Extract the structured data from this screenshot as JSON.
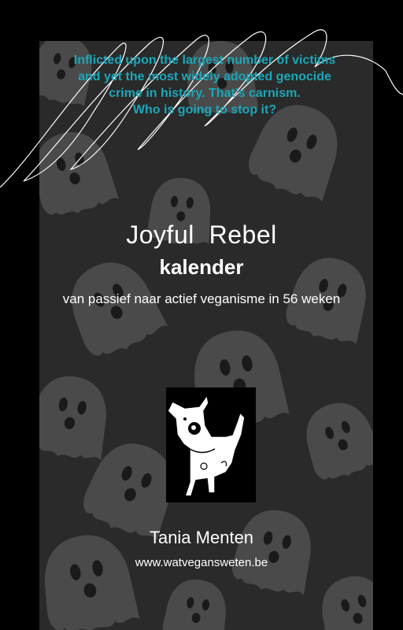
{
  "tagline": {
    "line1": "Inflicted upon the largest number of victims",
    "line2": "and yet the most widely adopted genocide",
    "line3": "crime in history. That’s carnism.",
    "line4": "Who is going to stop it?"
  },
  "title": {
    "line1": "Joyful  Rebel",
    "line2": "kalender",
    "subtitle": "van passief naar actief veganisme in 56 weken"
  },
  "author": "Tania Menten",
  "website": "www.watvegansweten.be",
  "colors": {
    "background": "#000000",
    "panel": "#2a2a2a",
    "tagline": "#1aa7b8",
    "text": "#ffffff"
  },
  "icons": [
    "ghost-pattern",
    "scribble",
    "dog-illustration"
  ]
}
